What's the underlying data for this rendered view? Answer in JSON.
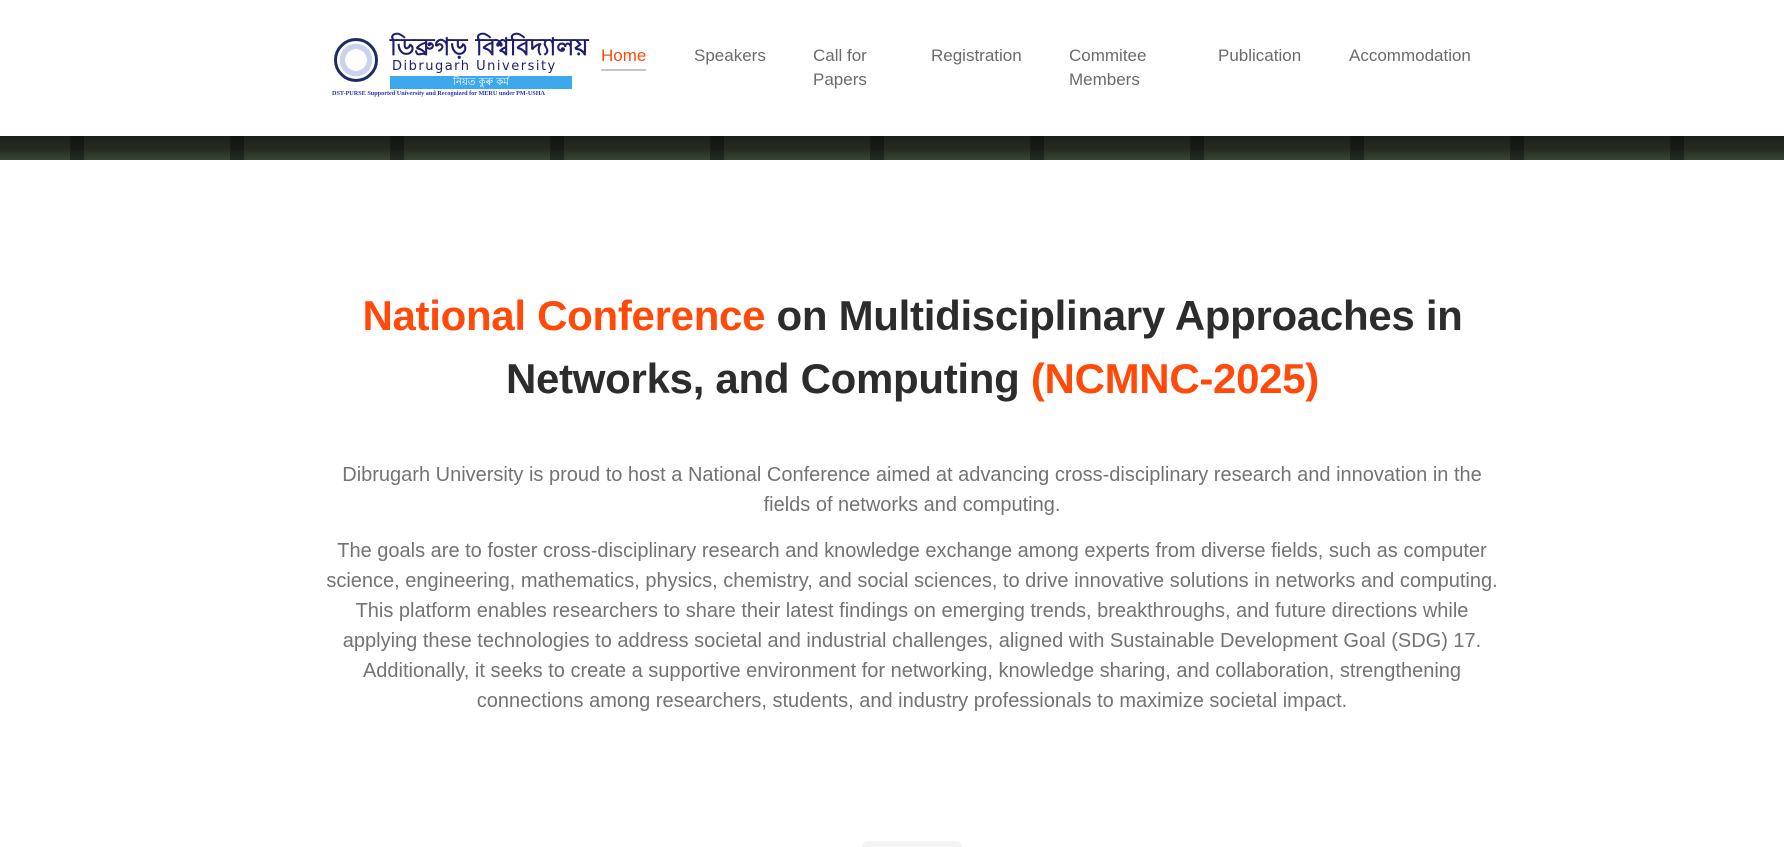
{
  "logo": {
    "bengali_name": "ডিব্ৰুগড় বিশ্ববিদ্যালয়",
    "english_name": "Dibrugarh University",
    "motto": "নিয়ত কুৰু কৰ্ম",
    "tagline": "DST-PURSE Supported University and Recognized for MERU under PM-USHA"
  },
  "nav": {
    "home": "Home",
    "speakers": "Speakers",
    "call_line1": "Call for",
    "call_line2": "Papers",
    "registration": "Registration",
    "committee_line1": "Commitee",
    "committee_line2": "Members",
    "publication": "Publication",
    "accommodation": "Accommodation"
  },
  "hero": {
    "title_accent_1": "National Conference",
    "title_middle": " on Multidisciplinary Approaches in Networks, and Computing ",
    "title_accent_2": "(NCMNC-2025)",
    "paragraph_1": "Dibrugarh University is proud to host a National Conference aimed at advancing cross-disciplinary research and innovation in the fields of networks and computing.",
    "paragraph_2": "The goals are to foster cross-disciplinary research and knowledge exchange among experts from diverse fields, such as computer science, engineering, mathematics, physics, chemistry, and social sciences, to drive innovative solutions in networks and computing. This platform enables researchers to share their latest findings on emerging trends, breakthroughs, and future directions while applying these technologies to address societal and industrial challenges, aligned with Sustainable Development Goal (SDG) 17. Additionally, it seeks to create a supportive environment for networking, knowledge sharing, and collaboration, strengthening connections among researchers, students, and industry professionals to maximize societal impact."
  },
  "colors": {
    "accent": "#ff4a0a",
    "heading": "#2c2c2c",
    "body_text": "#737373",
    "nav_text": "#6b6b6b"
  }
}
